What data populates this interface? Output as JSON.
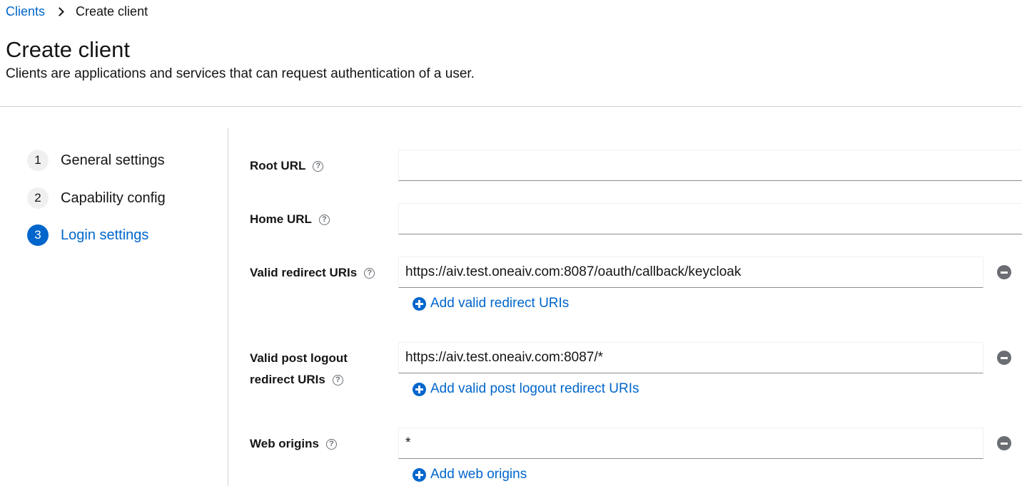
{
  "breadcrumb": {
    "parent": "Clients",
    "current": "Create client"
  },
  "page": {
    "title": "Create client",
    "description": "Clients are applications and services that can request authentication of a user."
  },
  "wizard": {
    "steps": [
      {
        "number": "1",
        "label": "General settings",
        "active": false
      },
      {
        "number": "2",
        "label": "Capability config",
        "active": false
      },
      {
        "number": "3",
        "label": "Login settings",
        "active": true
      }
    ]
  },
  "form": {
    "root_url": {
      "label": "Root URL",
      "value": ""
    },
    "home_url": {
      "label": "Home URL",
      "value": ""
    },
    "valid_redirect_uris": {
      "label": "Valid redirect URIs",
      "value": "https://aiv.test.oneaiv.com:8087/oauth/callback/keycloak",
      "add_label": "Add valid redirect URIs"
    },
    "valid_post_logout": {
      "label_line1": "Valid post logout",
      "label_line2": "redirect URIs",
      "value": "https://aiv.test.oneaiv.com:8087/*",
      "add_label": "Add valid post logout redirect URIs"
    },
    "web_origins": {
      "label": "Web origins",
      "value": "*",
      "add_label": "Add web origins"
    }
  },
  "help_glyph": "?",
  "colors": {
    "accent": "#0066cc",
    "text": "#151515",
    "muted_icon": "#6a6e73",
    "divider": "#d2d2d2"
  }
}
